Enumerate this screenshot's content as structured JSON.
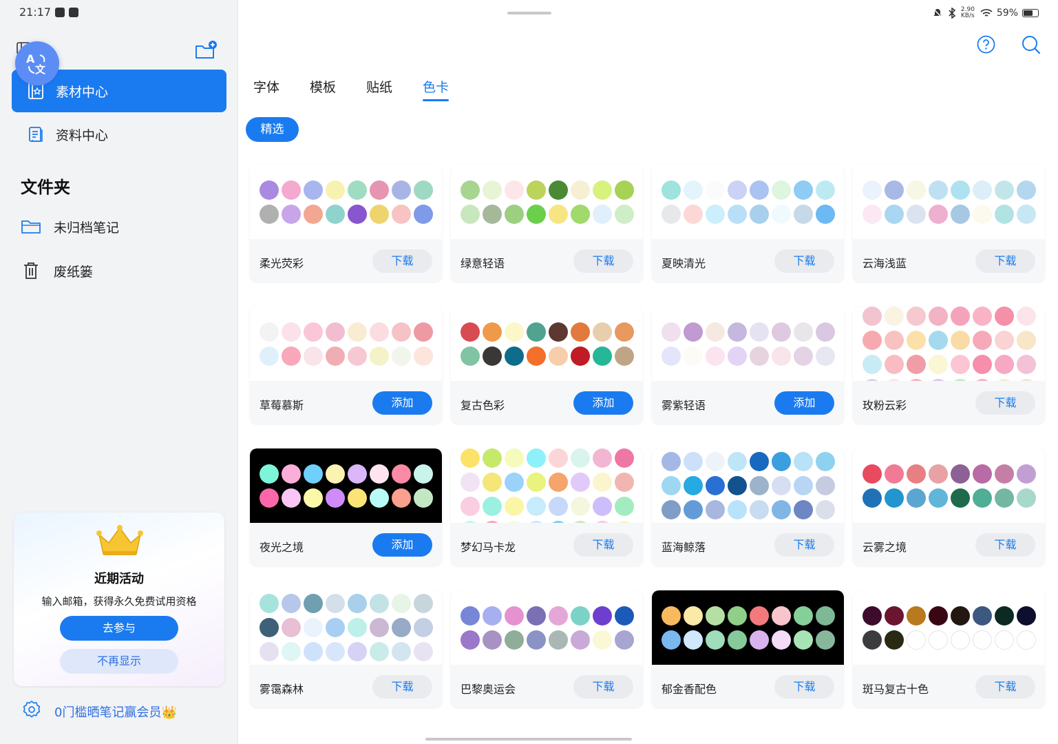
{
  "status_bar": {
    "time": "21:17",
    "net_speed": "2.90 KB/s",
    "battery": "59%"
  },
  "sidebar": {
    "nav": [
      {
        "label": "素材中心",
        "icon": "material-center-icon",
        "active": true
      },
      {
        "label": "资料中心",
        "icon": "document-center-icon",
        "active": false
      }
    ],
    "folders_title": "文件夹",
    "folders": [
      {
        "label": "未归档笔记",
        "icon": "folder-icon"
      },
      {
        "label": "废纸篓",
        "icon": "trash-icon"
      }
    ],
    "promo": {
      "title": "近期活动",
      "description": "输入邮箱，获得永久免费试用资格",
      "join_label": "去参与",
      "dismiss_label": "不再显示"
    },
    "member_link": "0门槛晒笔记赢会员👑"
  },
  "tabs": [
    {
      "label": "字体",
      "active": false
    },
    {
      "label": "模板",
      "active": false
    },
    {
      "label": "贴纸",
      "active": false
    },
    {
      "label": "色卡",
      "active": true
    }
  ],
  "filter_chip": "精选",
  "colors": {
    "accent": "#1a7bf0"
  },
  "cards": [
    {
      "name": "柔光荧彩",
      "button": "下载",
      "action": "download",
      "dark": false,
      "rows": [
        [
          "#a98ae0",
          "#f4a9cf",
          "#a7b6ee",
          "#f7f2b0",
          "#9fdcc1",
          "#e594b1",
          "#a9b4e6",
          "#9ed9c4"
        ],
        [
          "#b0b0b0",
          "#c8a5e9",
          "#f3a792",
          "#8fd3cd",
          "#8856cf",
          "#efd36d",
          "#f8c3c3",
          "#7e9ae8"
        ]
      ]
    },
    {
      "name": "绿意轻语",
      "button": "下载",
      "action": "download",
      "dark": false,
      "rows": [
        [
          "#a7d590",
          "#e7f5d6",
          "#fde6ea",
          "#bcd35c",
          "#4a8a35",
          "#f7efd4",
          "#d8f27e",
          "#a7d255"
        ],
        [
          "#c9e7bf",
          "#a5b99a",
          "#9ccf7f",
          "#6ad04b",
          "#f7e584",
          "#a0da6b",
          "#e1eefc",
          "#cfedc6"
        ]
      ]
    },
    {
      "name": "夏映清光",
      "button": "下载",
      "action": "download",
      "dark": false,
      "rows": [
        [
          "#9ee3de",
          "#e4f4fd",
          "#fbfbfb",
          "#cbd2f5",
          "#abc3f2",
          "#def5df",
          "#8ecbf5",
          "#bdeaf1"
        ],
        [
          "#e6e8ea",
          "#fdd7d6",
          "#cbeffc",
          "#b9dff8",
          "#a8d0ec",
          "#f0f9fd",
          "#c7d8e6",
          "#6cb9f4"
        ]
      ]
    },
    {
      "name": "云海浅蓝",
      "button": "下载",
      "action": "download",
      "dark": false,
      "rows": [
        [
          "#eaf3fd",
          "#a7b9e5",
          "#f7f7e6",
          "#bfe0f2",
          "#aee2f0",
          "#dbeefa",
          "#c2e5ea",
          "#b4d6ef"
        ],
        [
          "#fbe8f3",
          "#a9d6f1",
          "#dbe4ee",
          "#efafcf",
          "#a7c8e3",
          "#fcf9ed",
          "#b1e3e3",
          "#c7e7f5"
        ]
      ]
    },
    {
      "name": "草莓慕斯",
      "button": "添加",
      "action": "add",
      "dark": false,
      "rows": [
        [
          "#f3f3f3",
          "#fbe1ea",
          "#fbc6d7",
          "#f2bdd0",
          "#f8ecd3",
          "#fbdce1",
          "#f6c2c6",
          "#ee9aa4"
        ],
        [
          "#dff0fb",
          "#f9a7bb",
          "#f9e4ea",
          "#f1aeb2",
          "#f6c9d2",
          "#f6f2c8",
          "#f2f5ec",
          "#fce5da"
        ]
      ]
    },
    {
      "name": "复古色彩",
      "button": "添加",
      "action": "add",
      "dark": false,
      "rows": [
        [
          "#d84c51",
          "#ef9a4a",
          "#fbf7c8",
          "#4fa38f",
          "#5d3831",
          "#e27a3d",
          "#e7cfae",
          "#e8995f"
        ],
        [
          "#80c4a3",
          "#3a3836",
          "#0e6d8b",
          "#f36f2a",
          "#f7ceaa",
          "#bf1c24",
          "#25b797",
          "#bfa586"
        ]
      ]
    },
    {
      "name": "雾紫轻语",
      "button": "添加",
      "action": "add",
      "dark": false,
      "rows": [
        [
          "#f0dfee",
          "#c19ad2",
          "#f5e9e2",
          "#c5b8de",
          "#e5e2f1",
          "#dfc9e0",
          "#e9e6ea",
          "#dac8e2"
        ],
        [
          "#e4e4fb",
          "#fcfbf5",
          "#fbe3f0",
          "#e2d3f7",
          "#e7d3de",
          "#f8e4ea",
          "#e3d3e5",
          "#e6e7f0"
        ]
      ]
    },
    {
      "name": "玫粉云彩",
      "button": "下载",
      "action": "download",
      "dark": false,
      "rows": [
        [
          "#f2c4d0",
          "#fbf3e2",
          "#f6c9cf",
          "#f2b3c4",
          "#f5a3bb",
          "#f8b4c6",
          "#f590a9",
          "#fbe5eb"
        ],
        [
          "#f7a9b0",
          "#f7c3c0",
          "#fbe0a8",
          "#a4d9ee",
          "#fbdba5",
          "#f6a9b9",
          "#fbd3d5",
          "#f7e6c8"
        ],
        [
          "#c9ebf5",
          "#f8bcc2",
          "#ef9ea8",
          "#fbf6d3",
          "#fbc5d4",
          "#f68eac",
          "#f7a8c3",
          "#f3c2d6"
        ],
        [
          "#dfd0ea",
          "#fbe4ec",
          "#f4b3c3",
          "#d8c8ee",
          "#c6e7c8",
          "#f2b3c2",
          "#f4efcc",
          "#f0e5de"
        ]
      ]
    },
    {
      "name": "夜光之境",
      "button": "添加",
      "action": "add",
      "dark": true,
      "rows": [
        [
          "#7ef5d8",
          "#fcaedb",
          "#6fd1fb",
          "#fbf3b2",
          "#d9b7f8",
          "#fde4ee",
          "#fa8aa6",
          "#c8f4ec"
        ],
        [
          "#fb67a9",
          "#f9c6f5",
          "#fbf9a7",
          "#cf8cf8",
          "#fbe375",
          "#b8fbf6",
          "#fb9f8e",
          "#c3e7c5"
        ]
      ]
    },
    {
      "name": "梦幻马卡龙",
      "button": "下载",
      "action": "download",
      "dark": false,
      "rows": [
        [
          "#fbe36a",
          "#c6e96a",
          "#f5fbbb",
          "#8ef0f9",
          "#fbd5d8",
          "#d9f4ec",
          "#f2b6d2",
          "#ef77a3"
        ],
        [
          "#f1e3f3",
          "#f4e679",
          "#9bd2fb",
          "#e9f37e",
          "#f5a46b",
          "#e1c9f9",
          "#fbf5cd",
          "#f2b6b0"
        ],
        [
          "#fbcde0",
          "#9cf0e0",
          "#fbf6a6",
          "#c7ecfb",
          "#c6d9fb",
          "#f4f7dd",
          "#cdbdfa",
          "#a3ecbf"
        ],
        [
          "#c6f6e8",
          "#f6a2bd",
          "#fbf9df",
          "#cbe7fb",
          "#78cdf0",
          "#c9e9b7",
          "#fbc5e6",
          "#f2f7c7"
        ]
      ]
    },
    {
      "name": "蓝海鲸落",
      "button": "下载",
      "action": "download",
      "dark": false,
      "rows": [
        [
          "#a5b8e5",
          "#cde0fa",
          "#eef2fa",
          "#bfe6f8",
          "#1769c0",
          "#3a9ee0",
          "#b7e2f8",
          "#8ed2ef"
        ],
        [
          "#9ed8f0",
          "#27a9e1",
          "#2a6fd4",
          "#12528f",
          "#9cb3c9",
          "#d6dff1",
          "#b8d5f5",
          "#c5cbe1"
        ],
        [
          "#7f9dc6",
          "#639bd8",
          "#a7b7de",
          "#b8e3fa",
          "#c7dcf1",
          "#7fb6e5",
          "#6d86c4",
          "#dadfec"
        ]
      ]
    },
    {
      "name": "云雾之境",
      "button": "下载",
      "action": "download",
      "dark": false,
      "rows": [
        [
          "#e84a5f",
          "#f17a97",
          "#e77f83",
          "#e8a1a5",
          "#8e6196",
          "#b86ba4",
          "#c57fa7",
          "#c29fd3"
        ],
        [
          "#1f72b5",
          "#2195cf",
          "#5ba6d0",
          "#5fb6d8",
          "#1f6a4d",
          "#4fae95",
          "#73b7a3",
          "#a8d8cc"
        ]
      ]
    },
    {
      "name": "雾霭森林",
      "button": "下载",
      "action": "download",
      "dark": false,
      "rows": [
        [
          "#a7e3dd",
          "#b7c7ec",
          "#6f9fb0",
          "#d5dfe9",
          "#a8d0ea",
          "#c3e2e5",
          "#e6f5e5",
          "#c7d6da"
        ],
        [
          "#3e6078",
          "#e8bfd4",
          "#eaf3fb",
          "#a8cef3",
          "#bdf0e9",
          "#cbb9d3",
          "#97aac8",
          "#c3cfe4"
        ],
        [
          "#e5e1f1",
          "#def6f4",
          "#cfe2fb",
          "#d7e6fb",
          "#d6d2f6",
          "#c9ece8",
          "#d3e5ef",
          "#e8e3f3"
        ]
      ]
    },
    {
      "name": "巴黎奥运会",
      "button": "下载",
      "action": "download",
      "dark": false,
      "rows": [
        [
          "#7886d7",
          "#a6aff0",
          "#e593d0",
          "#7b6fb6",
          "#e5a6d8",
          "#7bd3c7",
          "#6e3fcf",
          "#1b5bb7"
        ],
        [
          "#9b78c8",
          "#a792c5",
          "#8fad98",
          "#8a93c5",
          "#a9b7b5",
          "#c9a9d7",
          "#fbf8d5",
          "#a7a5d2"
        ]
      ]
    },
    {
      "name": "郁金香配色",
      "button": "下载",
      "action": "download",
      "dark": true,
      "rows": [
        [
          "#f9b95f",
          "#fbe9a8",
          "#b6e0a3",
          "#8fcf87",
          "#f3797c",
          "#f8c5cc",
          "#85cf98",
          "#7fb894"
        ],
        [
          "#7bb8f0",
          "#cfe8fb",
          "#9fddbb",
          "#86c99a",
          "#d9b3ed",
          "#f2dcf8",
          "#a8e3b4",
          "#87b89c"
        ]
      ]
    },
    {
      "name": "斑马复古十色",
      "button": "下载",
      "action": "download",
      "dark": false,
      "rows": [
        [
          "#3d0c2c",
          "#6b1531",
          "#b8791f",
          "#3a0614",
          "#231811",
          "#3d5880",
          "#0c2a22",
          "#0e0e2e"
        ],
        [
          "#3c3c3e",
          "#2a2a14",
          "#ffffff",
          "#ffffff",
          "#ffffff",
          "#ffffff",
          "#ffffff",
          "#ffffff"
        ]
      ]
    }
  ]
}
